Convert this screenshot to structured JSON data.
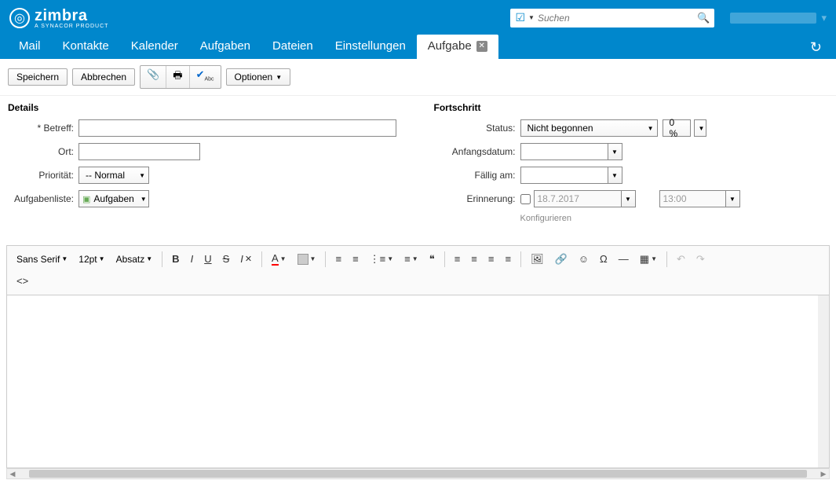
{
  "header": {
    "brand": "zimbra",
    "subbrand": "A SYNACOR PRODUCT",
    "search_placeholder": "Suchen"
  },
  "nav": {
    "tabs": [
      "Mail",
      "Kontakte",
      "Kalender",
      "Aufgaben",
      "Dateien",
      "Einstellungen"
    ],
    "active_tab": "Aufgabe"
  },
  "toolbar": {
    "save": "Speichern",
    "cancel": "Abbrechen",
    "options": "Optionen"
  },
  "details": {
    "title": "Details",
    "subject_label": "* Betreff:",
    "subject_value": "",
    "location_label": "Ort:",
    "location_value": "",
    "priority_label": "Priorität:",
    "priority_value": "-- Normal",
    "tasklist_label": "Aufgabenliste:",
    "tasklist_value": "Aufgaben"
  },
  "progress": {
    "title": "Fortschritt",
    "status_label": "Status:",
    "status_value": "Nicht begonnen",
    "percent_value": "0 %",
    "startdate_label": "Anfangsdatum:",
    "startdate_value": "",
    "duedate_label": "Fällig am:",
    "duedate_value": "",
    "reminder_label": "Erinnerung:",
    "reminder_date": "18.7.2017",
    "reminder_time": "13:00",
    "configure": "Konfigurieren"
  },
  "editor": {
    "font": "Sans Serif",
    "size": "12pt",
    "para": "Absatz"
  }
}
